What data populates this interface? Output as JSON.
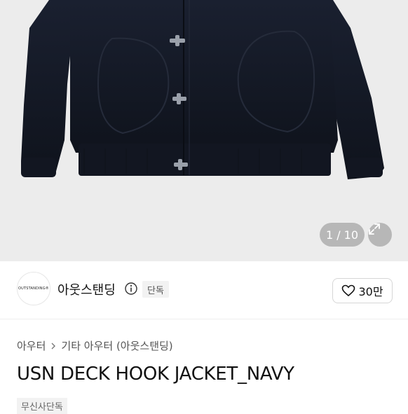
{
  "gallery": {
    "counter": "1 / 10",
    "image_alt_icon": "navy-deck-jacket-image",
    "expand_icon": "expand-icon"
  },
  "brand": {
    "logo_text": "OUTSTANDING®",
    "name": "아웃스탠딩",
    "info_icon": "info-icon",
    "badge": "단독"
  },
  "like": {
    "icon": "heart-icon",
    "count": "30만"
  },
  "breadcrumb": {
    "items": [
      "아우터",
      "기타 아우터 (아웃스탠딩)"
    ],
    "separator_icon": "chevron-right-icon"
  },
  "product": {
    "title": "USN DECK HOOK JACKET_NAVY",
    "sub_badge": "무신사단독"
  },
  "colors": {
    "hero_bg": "#ececec",
    "jacket": "#141a26",
    "accent_text": "#111111"
  }
}
